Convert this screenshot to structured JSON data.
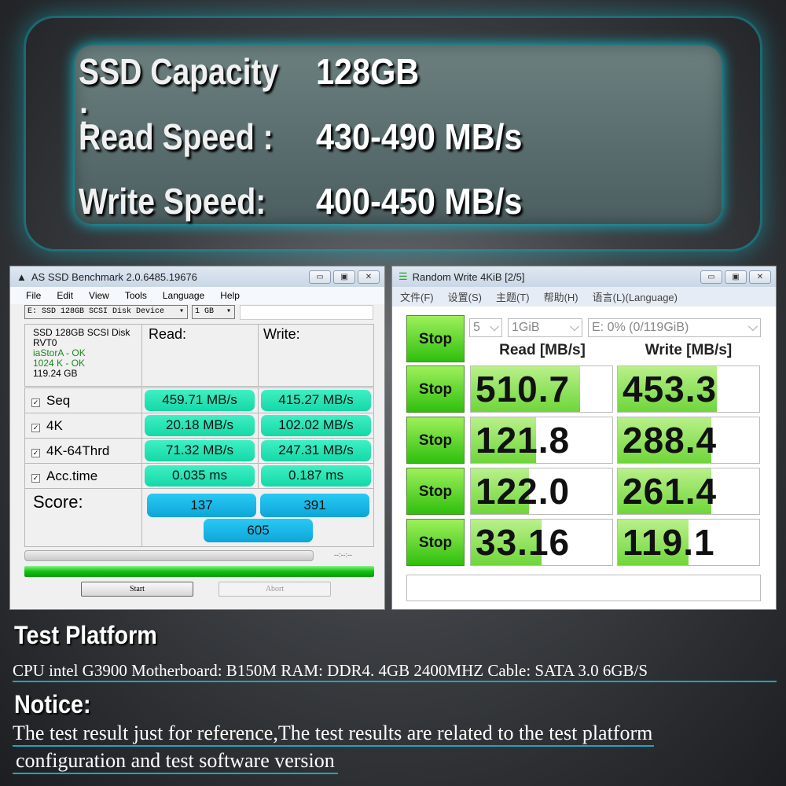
{
  "specs": {
    "capacity_label": "SSD Capacity :",
    "capacity": "128GB",
    "read_label": "Read Speed :",
    "read": "430-490 MB/s",
    "write_label": "Write Speed:",
    "write": "400-450 MB/s"
  },
  "asssd": {
    "title": "AS SSD Benchmark 2.0.6485.19676",
    "menu": [
      "File",
      "Edit",
      "View",
      "Tools",
      "Language",
      "Help"
    ],
    "drive": "E: SSD 128GB SCSI Disk Device",
    "size": "1 GB",
    "info": {
      "name": "SSD 128GB SCSI Disk",
      "fw": "RVT0",
      "driver": "iaStorA - OK",
      "align": "1024 K - OK",
      "capacity": "119.24 GB"
    },
    "read_header": "Read:",
    "write_header": "Write:",
    "rows": [
      {
        "label": "Seq",
        "read": "459.71 MB/s",
        "write": "415.27 MB/s"
      },
      {
        "label": "4K",
        "read": "20.18 MB/s",
        "write": "102.02 MB/s"
      },
      {
        "label": "4K-64Thrd",
        "read": "71.32 MB/s",
        "write": "247.31 MB/s"
      },
      {
        "label": "Acc.time",
        "read": "0.035 ms",
        "write": "0.187 ms"
      }
    ],
    "score_label": "Score:",
    "score_read": "137",
    "score_write": "391",
    "score_total": "605",
    "time": "--:--:--",
    "start": "Start",
    "abort": "Abort",
    "progress": 100
  },
  "cdm": {
    "title": "Random Write 4KiB [2/5]",
    "menu": [
      "文件(F)",
      "设置(S)",
      "主题(T)",
      "帮助(H)",
      "语言(L)(Language)"
    ],
    "count": "5",
    "size": "1GiB",
    "drive": "E: 0% (0/119GiB)",
    "stop": "Stop",
    "read_header": "Read [MB/s]",
    "write_header": "Write [MB/s]",
    "rows": [
      {
        "read": "510.7",
        "write": "453.3",
        "read_fill": 0.77,
        "write_fill": 0.7
      },
      {
        "read": "121.8",
        "write": "288.4",
        "read_fill": 0.46,
        "write_fill": 0.66
      },
      {
        "read": "122.0",
        "write": "261.4",
        "read_fill": 0.41,
        "write_fill": 0.66
      },
      {
        "read": "33.16",
        "write": "119.1",
        "read_fill": 0.5,
        "write_fill": 0.5
      }
    ]
  },
  "platform": {
    "heading": "Test Platform",
    "text": "CPU intel G3900  Motherboard: B150M    RAM: DDR4. 4GB 2400MHZ   Cable: SATA 3.0  6GB/S"
  },
  "notice": {
    "heading": "Notice:",
    "line1": "The test result just for reference,The test results are related to the test platform",
    "line2": "configuration  and test software version"
  }
}
